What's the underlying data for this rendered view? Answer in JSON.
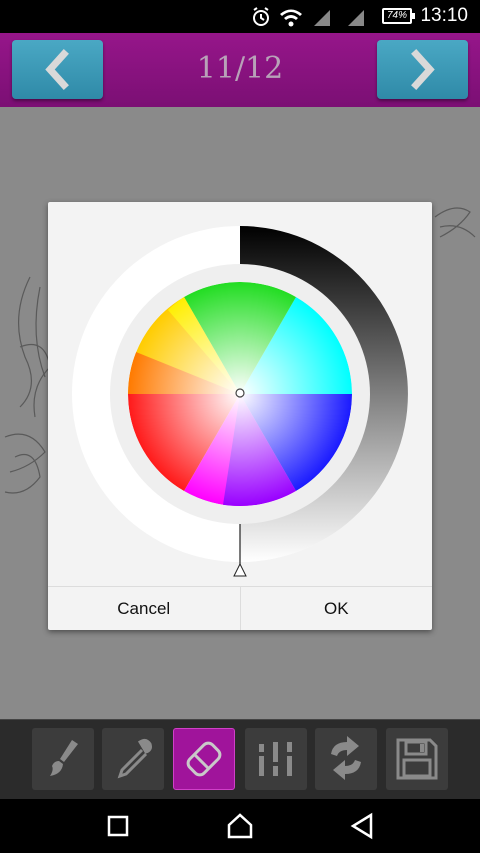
{
  "status_bar": {
    "time": "13:10",
    "battery": "74%",
    "icons": [
      "alarm-icon",
      "wifi-icon",
      "signal-icon",
      "signal-icon",
      "battery-icon"
    ]
  },
  "header": {
    "page_counter": "11/12",
    "prev_icon": "chevron-left-icon",
    "next_icon": "chevron-right-icon"
  },
  "color_dialog": {
    "cancel_label": "Cancel",
    "ok_label": "OK"
  },
  "toolbar": {
    "tools": [
      {
        "icon": "brush-icon"
      },
      {
        "icon": "eyedropper-icon"
      },
      {
        "icon": "eraser-icon",
        "active": true
      },
      {
        "icon": "sliders-icon"
      },
      {
        "icon": "swap-icon"
      },
      {
        "icon": "save-icon"
      }
    ]
  },
  "system_nav": [
    "recents-icon",
    "home-icon",
    "back-icon"
  ],
  "colors": {
    "header": "#8a127f",
    "nav_button": "#3a97b5",
    "active_tool": "#a0149b",
    "toolbar": "#2b2b2b"
  }
}
